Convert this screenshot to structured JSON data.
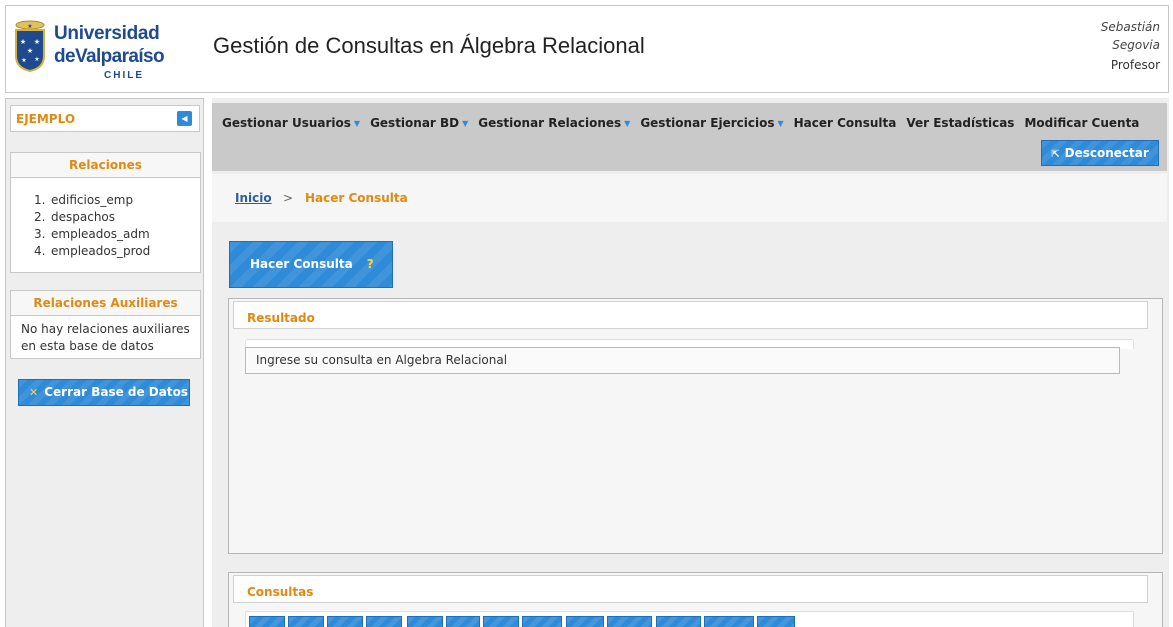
{
  "header": {
    "university_line1": "Universidad",
    "university_line2": "deValparaíso",
    "university_line3": "CHILE",
    "app_title": "Gestión de Consultas en Álgebra Relacional",
    "user_first": "Sebastián",
    "user_last": "Segovia",
    "user_role": "Profesor"
  },
  "sidebar": {
    "db_name": "EJEMPLO",
    "relations_title": "Relaciones",
    "relations": [
      {
        "num": "1.",
        "name": "edificios_emp"
      },
      {
        "num": "2.",
        "name": "despachos"
      },
      {
        "num": "3.",
        "name": "empleados_adm"
      },
      {
        "num": "4.",
        "name": "empleados_prod"
      }
    ],
    "aux_title": "Relaciones Auxiliares",
    "aux_text": "No hay relaciones auxiliares en esta base de datos",
    "close_db_label": "Cerrar Base de Datos"
  },
  "nav": {
    "items": [
      {
        "label": "Gestionar Usuarios",
        "dropdown": true
      },
      {
        "label": "Gestionar BD",
        "dropdown": true
      },
      {
        "label": "Gestionar Relaciones",
        "dropdown": true
      },
      {
        "label": "Gestionar Ejercicios",
        "dropdown": true
      },
      {
        "label": "Hacer Consulta",
        "dropdown": false
      },
      {
        "label": "Ver Estadísticas",
        "dropdown": false
      },
      {
        "label": "Modificar Cuenta",
        "dropdown": false
      }
    ],
    "logout_label": "Desconectar"
  },
  "breadcrumb": {
    "home": "Inicio",
    "separator": ">",
    "current": "Hacer Consulta"
  },
  "main": {
    "query_button_label": "Hacer Consulta",
    "query_help": "?",
    "result_title": "Resultado",
    "result_message": "Ingrese su consulta en Algebra Relacional",
    "queries_title": "Consultas"
  },
  "colors": {
    "accent_blue": "#2f8bd8",
    "accent_orange": "#e08a12",
    "brand_blue": "#1f4a8f"
  }
}
